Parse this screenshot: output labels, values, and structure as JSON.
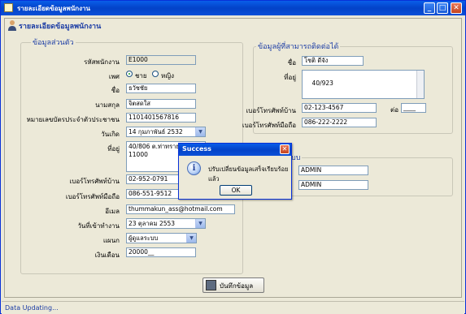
{
  "window": {
    "title": "รายละเอียดข้อมูลพนักงาน",
    "min": "_",
    "max": "□",
    "close": "✕"
  },
  "header": {
    "title": "รายละเอียดข้อมูลพนักงาน"
  },
  "personal": {
    "group_title": "ข้อมูลส่วนตัว",
    "employee_id_label": "รหัสพนักงาน",
    "employee_id": "E1000",
    "gender_label": "เพศ",
    "gender_male": "ชาย",
    "gender_female": "หญิง",
    "name_label": "ชื่อ",
    "name": "ธวัชชัย",
    "surname_label": "นามสกุล",
    "surname": "จิตสดใส",
    "id_card_label": "หมายเลขบัตรประจำตัวประชาชน",
    "id_card": "1101401567816",
    "birthdate_label": "วันเกิด",
    "birthdate": "14 กุมภาพันธ์   2532",
    "address_label": "ที่อยู่",
    "address": "40/806 ต.ท่าทราย อ.เ\n11000",
    "home_phone_label": "เบอร์โทรศัพท์บ้าน",
    "home_phone": "02-952-0791",
    "mobile_label": "เบอร์โทรศัพท์มือถือ",
    "mobile": "086-551-9512",
    "email_label": "อีเมล",
    "email": "thummakun_ass@hotmail.com",
    "start_date_label": "วันที่เข้าทำงาน",
    "start_date": "23  ตุลาคม      2553",
    "department_label": "แผนก",
    "department": "ผู้ดูแลระบบ",
    "salary_label": "เงินเดือน",
    "salary": "20000__"
  },
  "contact": {
    "group_title": "ข้อมูลผู้ที่สามารถติดต่อได้",
    "name_label": "ชื่อ",
    "name": "โชติ ดีจัง",
    "address_label": "ที่อยู่",
    "address": "40/923",
    "home_phone_label": "เบอร์โทรศัพท์บ้าน",
    "home_phone": "02-123-4567",
    "ext_label": "ต่อ",
    "ext": "____",
    "mobile_label": "เบอร์โทรศัพท์มือถือ",
    "mobile": "086-222-2222"
  },
  "system": {
    "group_title_partial": "บบ",
    "username": "ADMIN",
    "password": "ADMIN"
  },
  "save_button": {
    "label": "บันทึกข้อมูล"
  },
  "status_bar": {
    "text": "Data Updating..."
  },
  "dialog": {
    "title": "Success",
    "message": "ปรับเปลี่ยนข้อมูลเสร็จเรียบร้อยแล้ว",
    "ok_label": "OK",
    "close": "✕",
    "icon": "i"
  }
}
